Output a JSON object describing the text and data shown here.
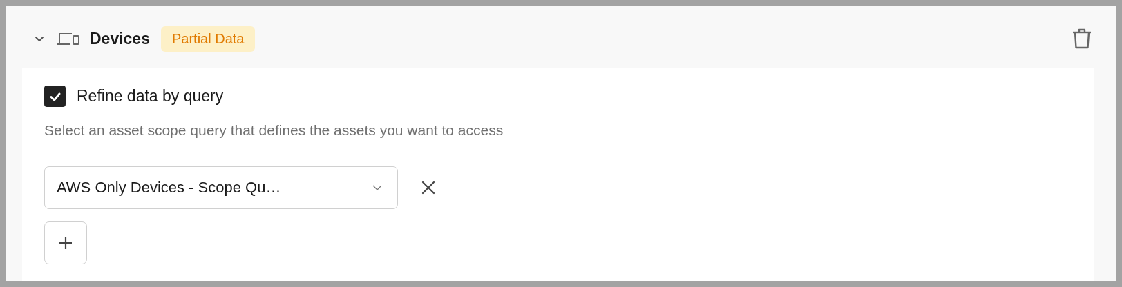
{
  "section": {
    "title": "Devices",
    "expanded": true,
    "badge": "Partial Data"
  },
  "refine": {
    "label": "Refine data by query",
    "checked": true,
    "description": "Select an asset scope query that defines the assets you want to access"
  },
  "queries": [
    {
      "value": "AWS Only Devices - Scope Qu…"
    }
  ]
}
